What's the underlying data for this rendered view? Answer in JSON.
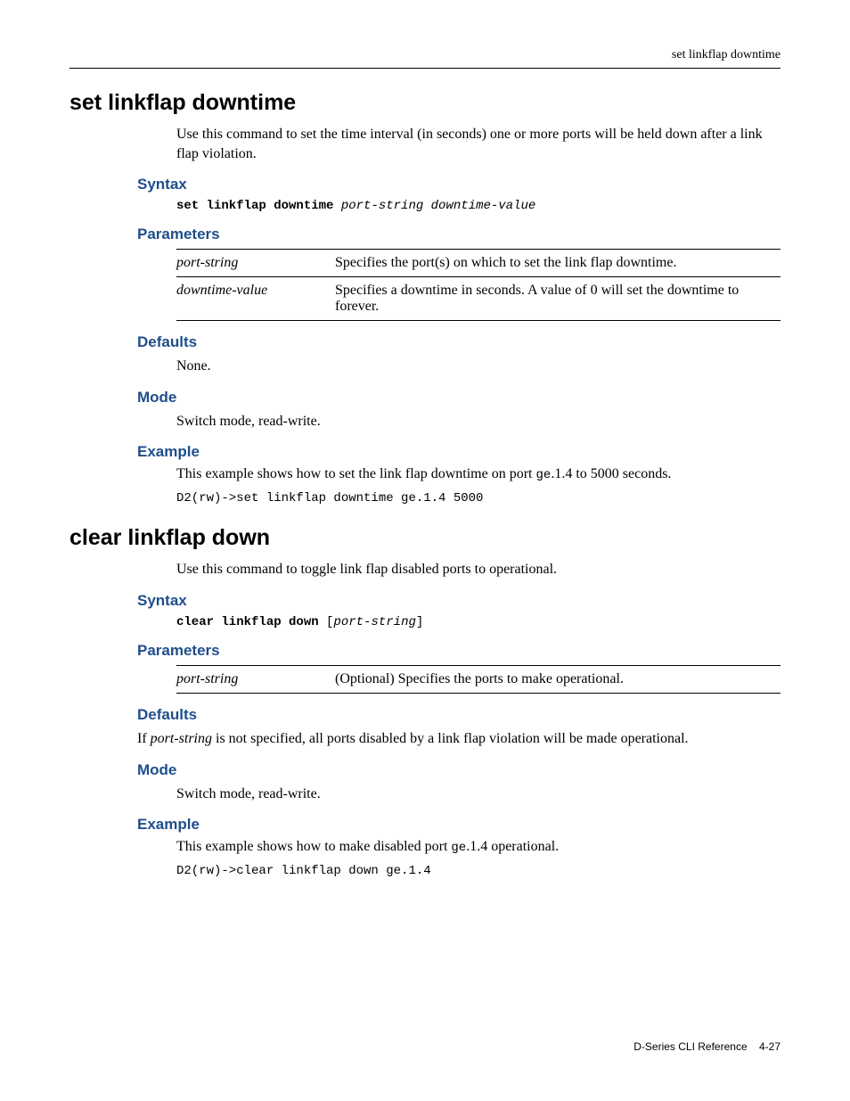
{
  "header": {
    "running_title": "set linkflap downtime"
  },
  "sections": [
    {
      "title": "set linkflap downtime",
      "intro": "Use this command to set the time interval (in seconds) one or more ports will be held down after a link flap violation.",
      "syntax_label": "Syntax",
      "syntax_cmd": "set linkflap downtime",
      "syntax_args": "port-string downtime-value",
      "parameters_label": "Parameters",
      "parameters": [
        {
          "name": "port-string",
          "desc": "Specifies the port(s) on which to set the link flap downtime."
        },
        {
          "name": "downtime-value",
          "desc": "Specifies a downtime in seconds. A value of 0 will set the downtime to forever."
        }
      ],
      "defaults_label": "Defaults",
      "defaults_text": "None.",
      "mode_label": "Mode",
      "mode_text": "Switch mode, read-write.",
      "example_label": "Example",
      "example_intro_pre": "This example shows how to set the link flap downtime on port ",
      "example_intro_code": "ge",
      "example_intro_post": ".1.4 to 5000 seconds.",
      "example_cmd": "D2(rw)->set linkflap downtime ge.1.4 5000"
    },
    {
      "title": "clear linkflap down",
      "intro": "Use this command to toggle link flap disabled ports to operational.",
      "syntax_label": "Syntax",
      "syntax_cmd": "clear linkflap down",
      "syntax_open": " [",
      "syntax_args": "port-string",
      "syntax_close": "]",
      "parameters_label": "Parameters",
      "parameters": [
        {
          "name": "port-string",
          "desc": "(Optional) Specifies the ports to make operational."
        }
      ],
      "defaults_label": "Defaults",
      "defaults_emph": "port-string",
      "defaults_pre": "If ",
      "defaults_post": " is not specified, all ports disabled by a link flap violation will be made operational.",
      "mode_label": "Mode",
      "mode_text": "Switch mode, read-write.",
      "example_label": "Example",
      "example_intro_pre": "This example shows how to make disabled port ",
      "example_intro_code": "ge",
      "example_intro_post": ".1.4 operational.",
      "example_cmd": "D2(rw)->clear linkflap down ge.1.4"
    }
  ],
  "footer": {
    "book": "D-Series CLI Reference",
    "page": "4-27"
  }
}
